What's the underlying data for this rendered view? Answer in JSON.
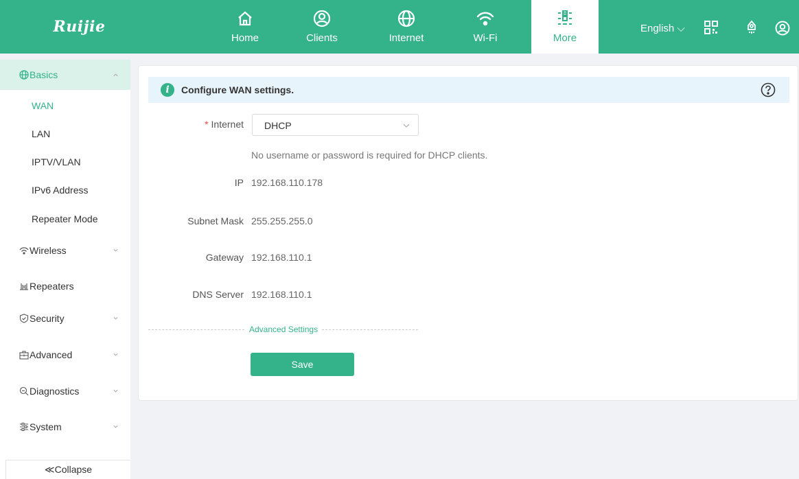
{
  "brand": {
    "logo_text": "Ruijie",
    "accent": "#34b38a"
  },
  "nav": {
    "items": [
      {
        "label": "Home",
        "icon": "home-icon"
      },
      {
        "label": "Clients",
        "icon": "user-circle-icon"
      },
      {
        "label": "Internet",
        "icon": "globe-icon"
      },
      {
        "label": "Wi-Fi",
        "icon": "wifi-icon"
      },
      {
        "label": "More",
        "icon": "sliders-icon",
        "active": true
      }
    ],
    "language": "English ⌵",
    "tools": [
      "qr-code-icon",
      "rocket-icon",
      "account-icon"
    ]
  },
  "sidebar": {
    "groups": [
      {
        "label": "Basics",
        "icon": "globe-icon",
        "expanded": true
      },
      {
        "label": "Wireless",
        "icon": "wifi-icon"
      },
      {
        "label": "Repeaters",
        "icon": "repeater-icon"
      },
      {
        "label": "Security",
        "icon": "shield-icon"
      },
      {
        "label": "Advanced",
        "icon": "toolbox-icon"
      },
      {
        "label": "Diagnostics",
        "icon": "search-icon"
      },
      {
        "label": "System",
        "icon": "settings-icon"
      }
    ],
    "basics_items": [
      "WAN",
      "LAN",
      "IPTV/VLAN",
      "IPv6 Address",
      "Repeater Mode"
    ],
    "active_item": "WAN",
    "collapse_label": "≪Collapse"
  },
  "main": {
    "banner_title": "Configure WAN settings.",
    "internet": {
      "label": "Internet",
      "required_mark": "*",
      "value": "DHCP"
    },
    "hint": "No username or password is required for DHCP clients.",
    "fields": [
      {
        "label": "IP",
        "value": "192.168.110.178"
      },
      {
        "label": "Subnet Mask",
        "value": "255.255.255.0"
      },
      {
        "label": "Gateway",
        "value": "192.168.110.1"
      },
      {
        "label": "DNS Server",
        "value": "192.168.110.1"
      }
    ],
    "advanced_label": "Advanced Settings",
    "save_label": "Save"
  }
}
